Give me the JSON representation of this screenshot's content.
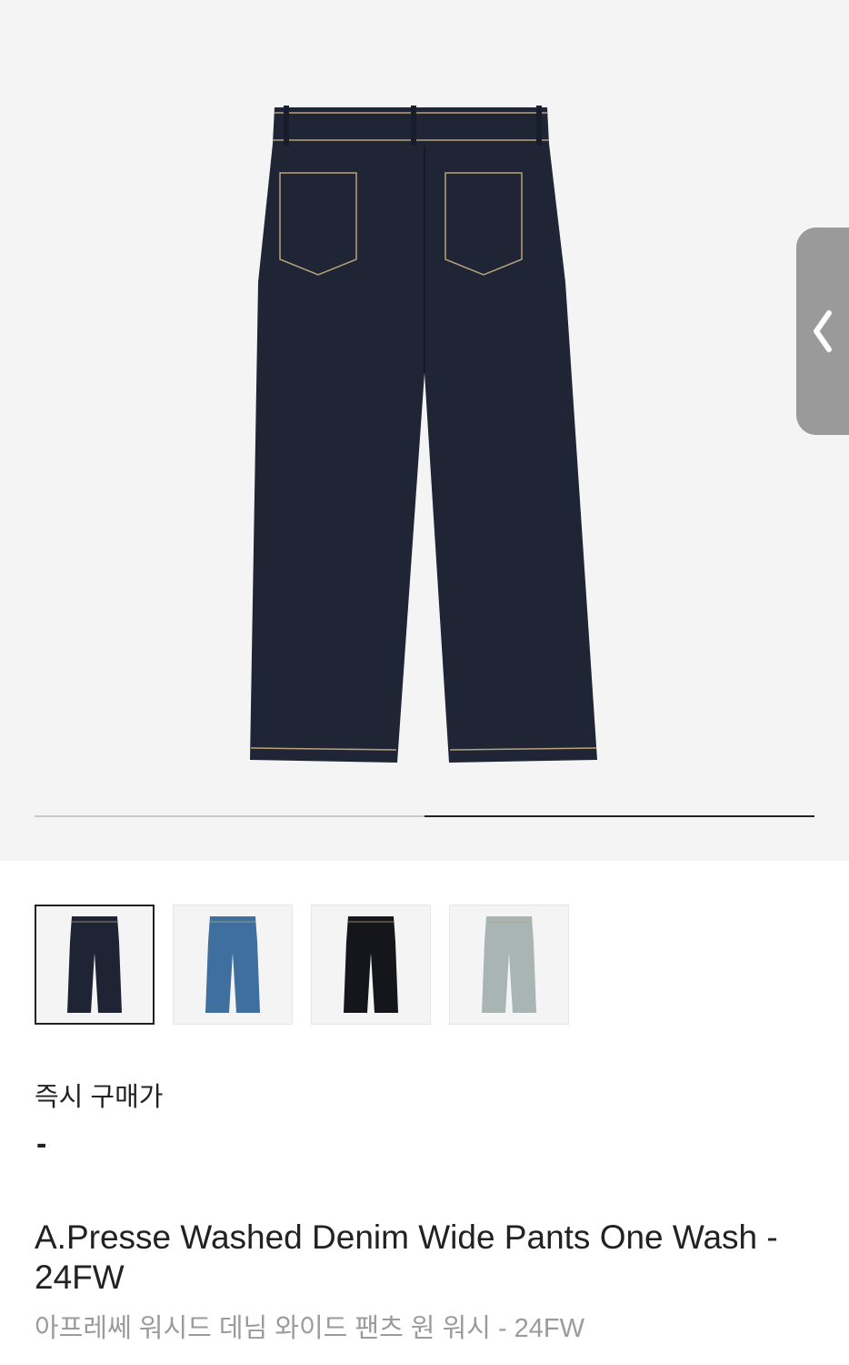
{
  "gallery": {
    "current_index": 2,
    "total_images": 2,
    "progress_fraction": 0.5
  },
  "thumbnails": [
    {
      "variant": "dark-indigo raw",
      "color": "#1e2433",
      "selected": true
    },
    {
      "variant": "medium blue wash",
      "color": "#3f6f9e",
      "selected": false
    },
    {
      "variant": "black",
      "color": "#15161b",
      "selected": false
    },
    {
      "variant": "light vintage wash",
      "color": "#a9b4b4",
      "selected": false
    }
  ],
  "price": {
    "label": "즉시 구매가",
    "value": "-"
  },
  "product": {
    "name_en": "A.Presse Washed Denim Wide Pants One Wash - 24FW",
    "name_ko": "아프레쎄 워시드 데님 와이드 팬츠 원 워시 - 24FW"
  },
  "colors": {
    "hero_bg": "#f4f4f4",
    "denim": "#1f2535",
    "stitch": "#b8a27a",
    "text_primary": "#222222",
    "text_secondary": "#9b9b9b",
    "handle_bg": "#9a9a9a"
  },
  "icons": {
    "side_handle": "chevron-left-icon"
  }
}
